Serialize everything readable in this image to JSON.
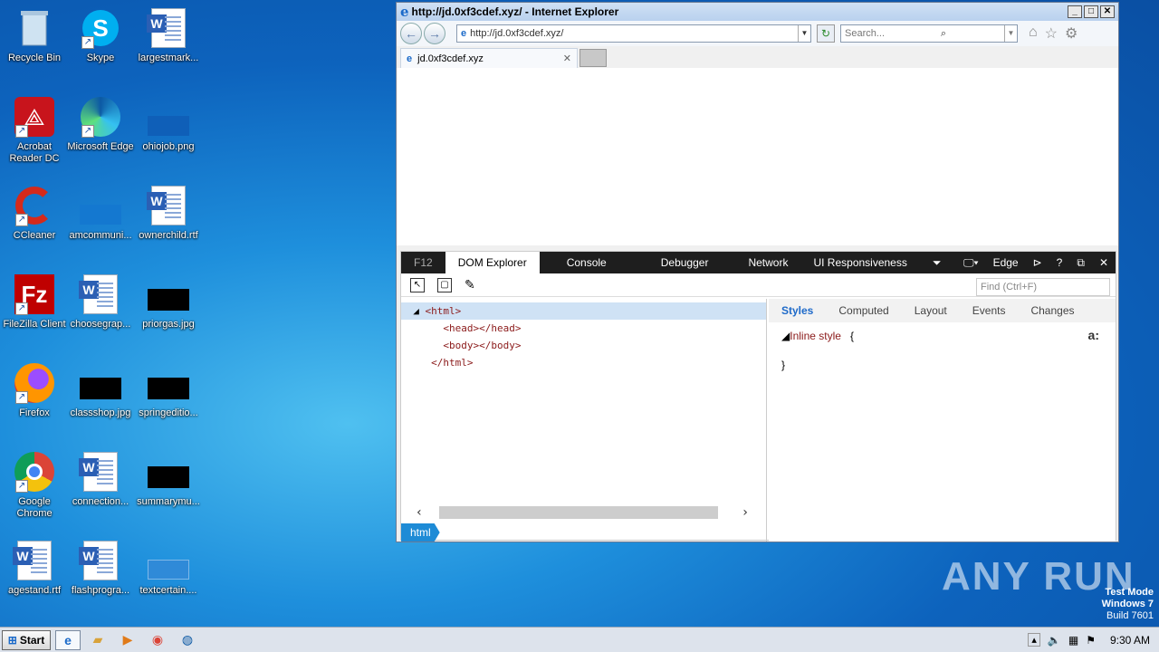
{
  "desktop": {
    "icons": [
      {
        "label": "Recycle Bin"
      },
      {
        "label": "Skype"
      },
      {
        "label": "largestmark..."
      },
      {
        "label": "Acrobat Reader DC"
      },
      {
        "label": "Microsoft Edge"
      },
      {
        "label": "ohiojob.png"
      },
      {
        "label": "CCleaner"
      },
      {
        "label": "amcommuni..."
      },
      {
        "label": "ownerchild.rtf"
      },
      {
        "label": "FileZilla Client"
      },
      {
        "label": "choosegrap..."
      },
      {
        "label": "priorgas.jpg"
      },
      {
        "label": "Firefox"
      },
      {
        "label": "classshop.jpg"
      },
      {
        "label": "springeditio..."
      },
      {
        "label": "Google Chrome"
      },
      {
        "label": "connection..."
      },
      {
        "label": "summarymu..."
      },
      {
        "label": "agestand.rtf"
      },
      {
        "label": "flashprogra..."
      },
      {
        "label": "textcertain...."
      }
    ]
  },
  "browser": {
    "title": "http://jd.0xf3cdef.xyz/ - Internet Explorer",
    "address": "http://jd.0xf3cdef.xyz/",
    "search_placeholder": "Search...",
    "tab_label": "jd.0xf3cdef.xyz"
  },
  "devtools": {
    "f12_label": "F12",
    "tabs": [
      "DOM Explorer",
      "Console",
      "Debugger",
      "Network",
      "UI Responsiveness"
    ],
    "mode_label": "Edge",
    "find_placeholder": "Find (Ctrl+F)",
    "dom": [
      "<html>",
      "<head></head>",
      "<body></body>",
      "</html>"
    ],
    "breadcrumb": "html",
    "style_tabs": [
      "Styles",
      "Computed",
      "Layout",
      "Events",
      "Changes"
    ],
    "inline_style_label": "Inline style",
    "brace_open": "{",
    "brace_close": "}"
  },
  "watermark": {
    "text": "ANY RUN",
    "test_mode": "Test Mode",
    "os": "Windows 7",
    "build": "Build 7601"
  },
  "taskbar": {
    "start_label": "Start",
    "time": "9:30 AM"
  }
}
